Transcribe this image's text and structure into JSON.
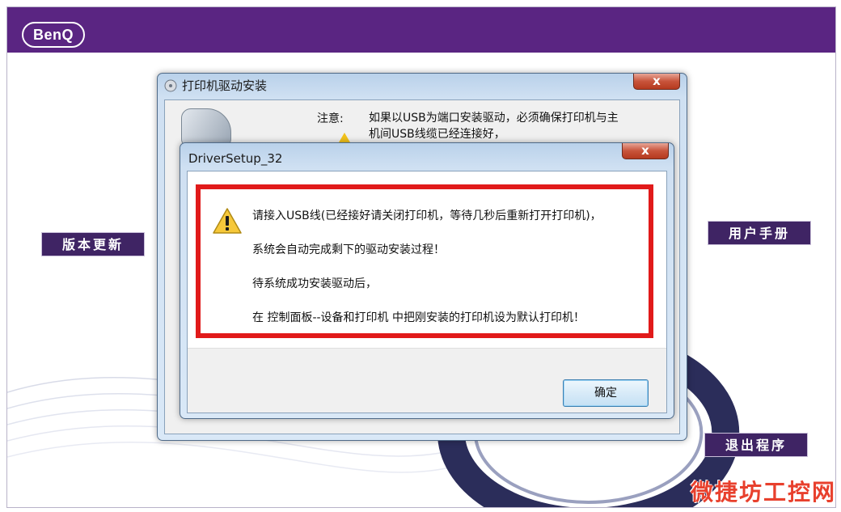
{
  "brand": {
    "logo": "BenQ"
  },
  "side_buttons": {
    "update": "版本更新",
    "manual": "用户手册",
    "exit": "退出程序"
  },
  "back_window": {
    "title": "打印机驱动安装",
    "close": "x",
    "notice_label": "注意:",
    "notice_text": "如果以USB为端口安装驱动，必须确保打印机与主机间USB线缆已经连接好，"
  },
  "dialog": {
    "title": "DriverSetup_32",
    "close": "x",
    "messages": [
      "请接入USB线(已经接好请关闭打印机，等待几秒后重新打开打印机)，",
      "系统会自动完成剩下的驱动安装过程！",
      "待系统成功安装驱动后，",
      "在 控制面板--设备和打印机 中把刚安装的打印机设为默认打印机！"
    ],
    "ok_button": "确定"
  },
  "watermark": "微捷坊工控网",
  "colors": {
    "brand_purple": "#5a2582",
    "button_purple": "#3f2464",
    "highlight_red": "#e11a1a",
    "warning_yellow": "#f2c21b"
  }
}
